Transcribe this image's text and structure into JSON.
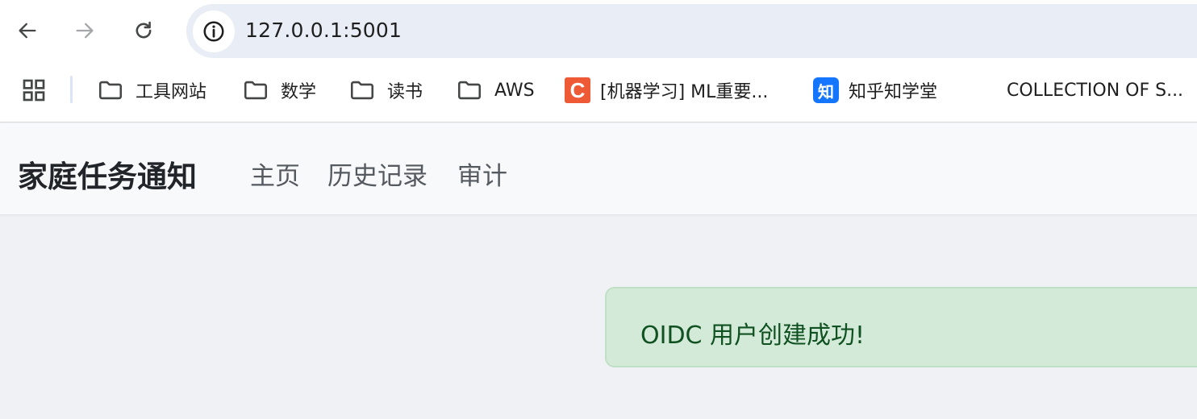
{
  "browser": {
    "url": "127.0.0.1:5001"
  },
  "bookmarks": [
    {
      "label": "工具网站",
      "icon": "folder-icon"
    },
    {
      "label": "数学",
      "icon": "folder-icon"
    },
    {
      "label": "读书",
      "icon": "folder-icon"
    },
    {
      "label": "AWS",
      "icon": "folder-icon"
    },
    {
      "label": "[机器学习] ML重要...",
      "icon": "csdn-icon",
      "icon_text": "C"
    },
    {
      "label": "知乎知学堂",
      "icon": "zhihu-icon",
      "icon_text": "知"
    },
    {
      "label": "COLLECTION OF S..."
    }
  ],
  "app": {
    "brand": "家庭任务通知",
    "nav": {
      "home": "主页",
      "history": "历史记录",
      "audit": "审计"
    }
  },
  "alert": {
    "message": "OIDC 用户创建成功!"
  },
  "colors": {
    "alert_bg": "#d4ead8",
    "alert_text": "#0f5121",
    "csdn": "#ee5a36",
    "zhihu": "#1476fe"
  }
}
